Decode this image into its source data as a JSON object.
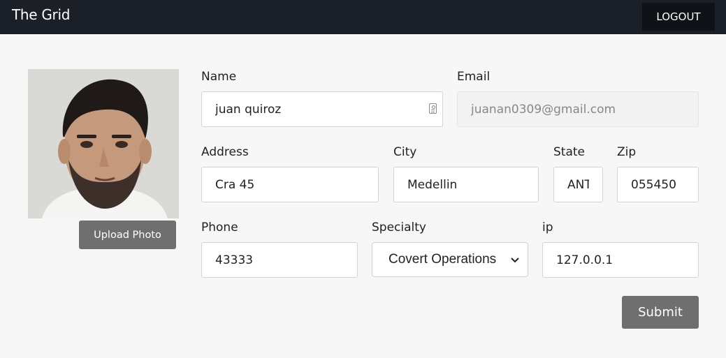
{
  "app": {
    "title": "The Grid",
    "logout_label": "LOGOUT"
  },
  "profile": {
    "upload_label": "Upload Photo"
  },
  "form": {
    "name": {
      "label": "Name",
      "value": "juan quiroz"
    },
    "email": {
      "label": "Email",
      "value": "juanan0309@gmail.com"
    },
    "address": {
      "label": "Address",
      "value": "Cra 45"
    },
    "city": {
      "label": "City",
      "value": "Medellin"
    },
    "state": {
      "label": "State",
      "value": "ANT"
    },
    "zip": {
      "label": "Zip",
      "value": "055450"
    },
    "phone": {
      "label": "Phone",
      "value": "43333"
    },
    "specialty": {
      "label": "Specialty",
      "value": "Covert Operations"
    },
    "ip": {
      "label": "ip",
      "value": "127.0.0.1"
    },
    "submit_label": "Submit"
  },
  "icons": {
    "contact": "contact-card-icon",
    "select": "chevron-down-icon"
  }
}
